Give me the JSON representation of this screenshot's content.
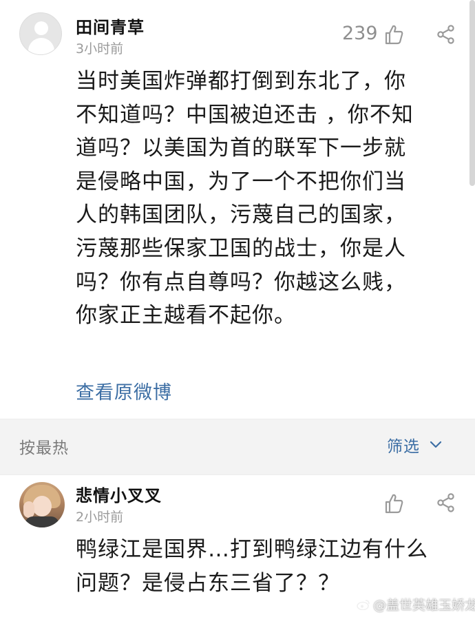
{
  "comments": [
    {
      "username": "田间青草",
      "time": "3小时前",
      "likes": "239",
      "text_lines": [
        "当时美国炸弹都打倒到东北了，你",
        "不知道吗？中国被迫还击 ，你不知",
        "道吗？以美国为首的联军下一步就",
        "是侵略中国，为了一个不把你们当",
        "人的韩国团队，污蔑自己的国家，",
        "污蔑那些保家卫国的战士，你是人",
        "吗？你有点自尊吗？你越这么贱，",
        "你家正主越看不起你。"
      ],
      "view_original": "查看原微博"
    },
    {
      "username": "悲情小叉叉",
      "time": "2小时前",
      "likes": "",
      "text_lines": [
        "鸭绿江是国界…打到鸭绿江边有什么",
        "问题？是侵占东三省了？？"
      ]
    }
  ],
  "sort_bar": {
    "sort_label": "按最热",
    "filter_label": "筛选"
  },
  "watermark": "@盖世英雄玉娇龙",
  "icons": {
    "like": "thumbs-up-icon",
    "share": "share-icon",
    "filter_chevron": "chevron-down-icon",
    "weibo": "weibo-logo-icon"
  },
  "colors": {
    "link": "#3c6ea4",
    "meta_gray": "#9a9a9a",
    "band": "#f3f3f3"
  }
}
